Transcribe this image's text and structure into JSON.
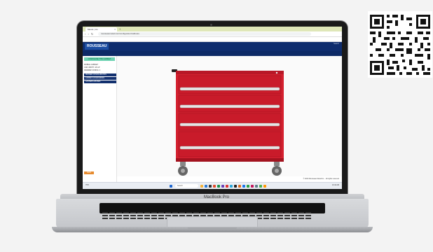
{
  "browser": {
    "tab_title": "Muuto | Lis",
    "tab_close": "×",
    "new_tab": "+",
    "nav_buttons": "‹ › ↻",
    "url": "rousseaumetal.com/configurator/cabinets",
    "bookmarks": [
      "Import favorites",
      "Rousseau",
      "Google Maps",
      "YouTube",
      "Gmail",
      "Web",
      "Configurator",
      "News",
      "More"
    ]
  },
  "site": {
    "logo": "ROUSSEAU",
    "top_right": "Search",
    "nav": [
      "PRODUCTS",
      "INDUSTRIES",
      "CATALOG",
      "CONFIGURATOR",
      "SERVICES",
      "CONTACT",
      "GET A QUOTE"
    ],
    "nav_active_index": 6
  },
  "left_panel": {
    "green_button": "CONFIGURE THIS CABINET",
    "lines": [
      "MOBILE CABINET",
      "CAB. WIDTH: 48 1/4\"",
      "DRAWER CONFIG: 4"
    ],
    "buttons": [
      "DRAWER CONFIGURATION",
      "CABINET ACCESSORIES",
      "CASTERS & BASES"
    ],
    "orange_button": "SAVE"
  },
  "product": {
    "name": "Mobile drawer cabinet",
    "body_color": "#d4202f",
    "drawer_count": 4
  },
  "footer": {
    "copyright": "© 2023 Rousseau Metal Inc. - All rights reserved",
    "search_placeholder": "Search",
    "weather": "75°F",
    "clock": "10:42 AM"
  },
  "laptop": {
    "brand": "MacBook Pro"
  }
}
